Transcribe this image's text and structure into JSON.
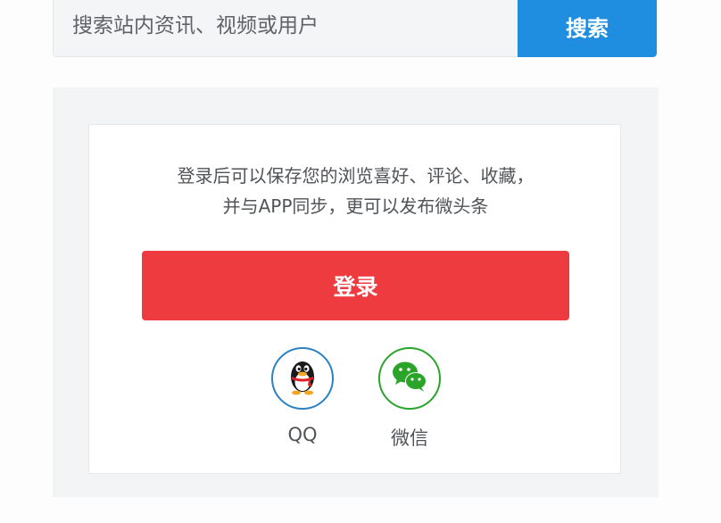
{
  "search": {
    "placeholder": "搜索站内资讯、视频或用户",
    "value": "",
    "button_label": "搜索"
  },
  "login": {
    "tip_line1": "登录后可以保存您的浏览喜好、评论、收藏，",
    "tip_line2": "并与APP同步，更可以发布微头条",
    "button_label": "登录",
    "social": [
      {
        "label": "QQ",
        "icon": "qq-penguin-icon"
      },
      {
        "label": "微信",
        "icon": "wechat-icon"
      }
    ]
  },
  "colors": {
    "search_button": "#1f8ee1",
    "login_button": "#ee3b40",
    "qq_ring": "#2a81c4",
    "wechat_ring": "#2aa52a"
  }
}
